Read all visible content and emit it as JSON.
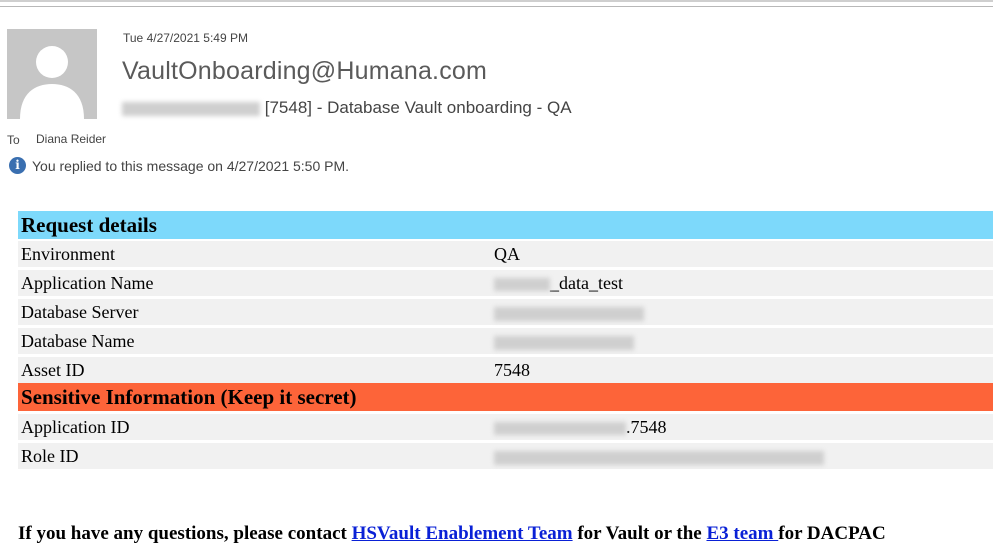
{
  "message": {
    "date": "Tue 4/27/2021 5:49 PM",
    "from": "VaultOnboarding@Humana.com",
    "subject": "[7548] - Database Vault onboarding - QA",
    "to_label": "To",
    "to": "Diana Reider",
    "info": "You replied to this message on 4/27/2021 5:50 PM."
  },
  "request": {
    "section_title": "Request details",
    "rows": [
      {
        "label": "Environment",
        "value": "QA"
      },
      {
        "label": "Application Name",
        "value": "_data_test"
      },
      {
        "label": "Database Server",
        "value": ""
      },
      {
        "label": "Database Name",
        "value": ""
      },
      {
        "label": "Asset ID",
        "value": "7548"
      }
    ]
  },
  "sensitive": {
    "section_title": "Sensitive Information (Keep it secret)",
    "rows": [
      {
        "label": "Application ID",
        "value": ".7548"
      },
      {
        "label": "Role ID",
        "value": ""
      }
    ]
  },
  "footer": {
    "prefix": "If you have any questions, please contact ",
    "link1": "HSVault Enablement Team",
    "middle": " for Vault or the ",
    "link2": "E3 team ",
    "suffix": "for DACPAC"
  },
  "colors": {
    "request_header": "#7dd9fb",
    "sensitive_header": "#fd6439",
    "link": "#0a21d6"
  }
}
